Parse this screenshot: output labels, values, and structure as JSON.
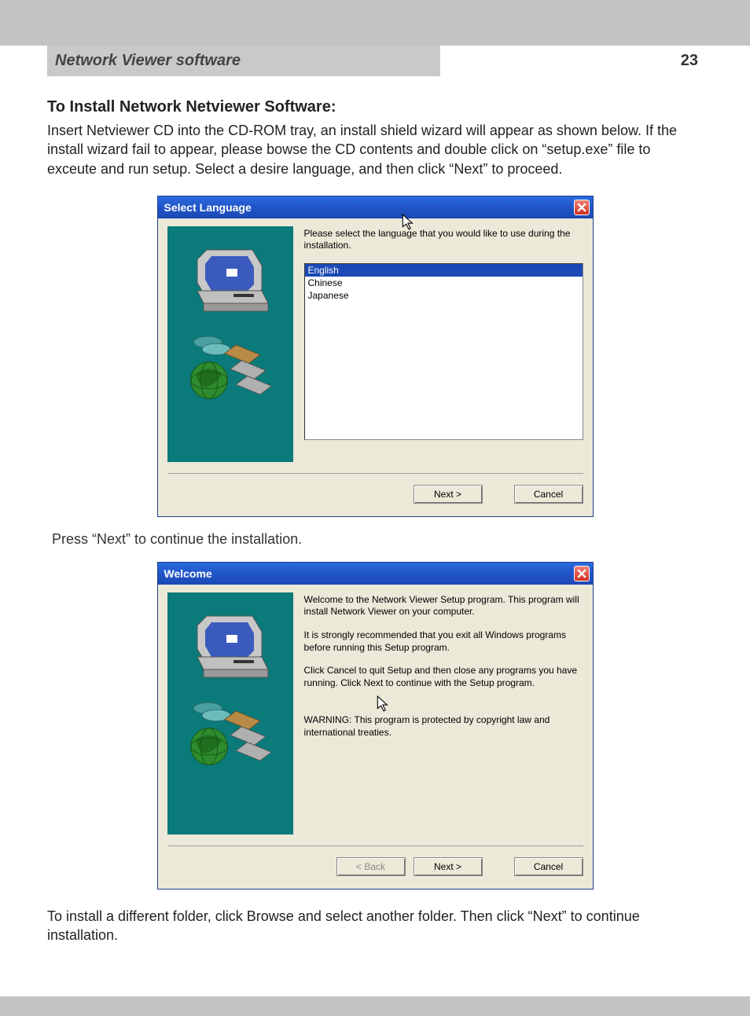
{
  "header": {
    "section_title": "Network Viewer software",
    "page_number": "23"
  },
  "text": {
    "heading": "To Install Network Netviewer Software:",
    "intro": "Insert Netviewer CD into the CD-ROM tray, an install shield wizard will appear as shown below. If the install wizard fail to appear, please bowse the CD contents and double click on “setup.exe” file to exceute and run setup.  Select a desire language, and then click “Next” to proceed.",
    "mid": "Press “Next” to continue the installation.",
    "outro": "To install a different folder, click Browse and select another folder. Then click “Next” to continue installation."
  },
  "dialog1": {
    "title": "Select Language",
    "prompt": "Please select the language that you would like to use during the installation.",
    "options": [
      "English",
      "Chinese",
      "Japanese"
    ],
    "selected_index": 0,
    "buttons": {
      "next": "Next >",
      "cancel": "Cancel"
    }
  },
  "dialog2": {
    "title": "Welcome",
    "para1": "Welcome to the Network Viewer Setup program. This program will install Network Viewer on your computer.",
    "para2": "It is strongly recommended that you exit all Windows programs before running this Setup program.",
    "para3": "Click Cancel to quit Setup and then close any programs you have running. Click Next to continue with the Setup program.",
    "para4": "WARNING: This program is protected by copyright law and international treaties.",
    "buttons": {
      "back": "< Back",
      "next": "Next >",
      "cancel": "Cancel"
    }
  },
  "icons": {
    "close": "close-icon",
    "cursor": "cursor-icon"
  }
}
